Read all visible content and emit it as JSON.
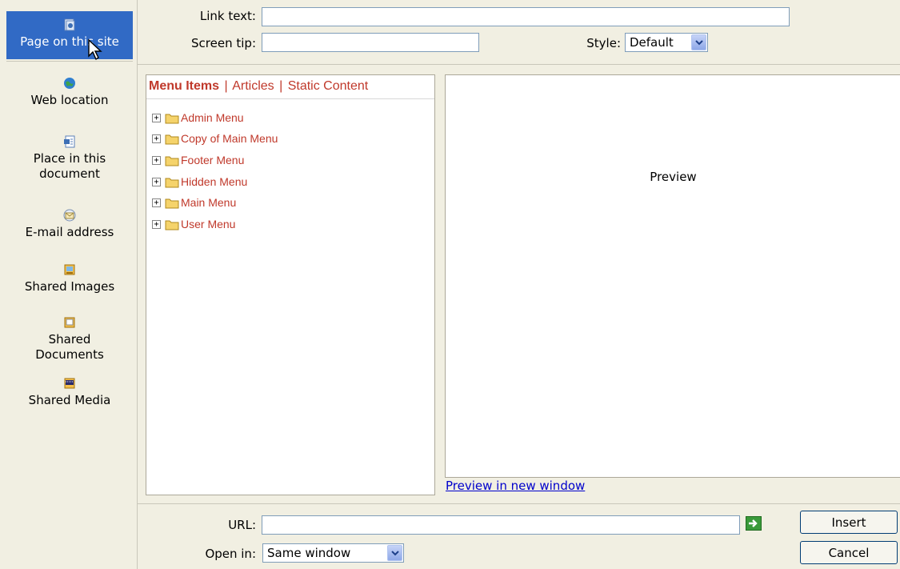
{
  "sidebar": {
    "items": [
      {
        "label": "Page on this site",
        "icon": "page-icon"
      },
      {
        "label": "Web location",
        "icon": "globe-icon"
      },
      {
        "label": "Place in this document",
        "icon": "document-anchor-icon"
      },
      {
        "label": "E-mail address",
        "icon": "envelope-icon"
      },
      {
        "label": "Shared Images",
        "icon": "images-icon"
      },
      {
        "label": "Shared Documents",
        "icon": "documents-icon"
      },
      {
        "label": "Shared Media",
        "icon": "media-icon"
      }
    ]
  },
  "form": {
    "link_text_label": "Link text:",
    "link_text_value": "",
    "screen_tip_label": "Screen tip:",
    "screen_tip_value": "",
    "style_label": "Style:",
    "style_value": "Default"
  },
  "tree": {
    "tabs": [
      {
        "label": "Menu Items",
        "active": true
      },
      {
        "label": "Articles",
        "active": false
      },
      {
        "label": "Static Content",
        "active": false
      }
    ],
    "tab_separator": "|",
    "nodes": [
      {
        "label": "Admin Menu",
        "expander": "+"
      },
      {
        "label": "Copy of Main Menu",
        "expander": "+"
      },
      {
        "label": "Footer Menu",
        "expander": "+"
      },
      {
        "label": "Hidden Menu",
        "expander": "+"
      },
      {
        "label": "Main Menu",
        "expander": "+"
      },
      {
        "label": "User Menu",
        "expander": "+"
      }
    ]
  },
  "preview": {
    "text": "Preview",
    "new_window_link": "Preview in new window"
  },
  "bottom": {
    "url_label": "URL:",
    "url_value": "",
    "open_in_label": "Open in:",
    "open_in_value": "Same window",
    "insert_label": "Insert",
    "cancel_label": "Cancel"
  },
  "colors": {
    "selection": "#316ac5",
    "tree_text": "#c0392b",
    "link": "#0000cc",
    "dialog_bg": "#f1efe2"
  }
}
